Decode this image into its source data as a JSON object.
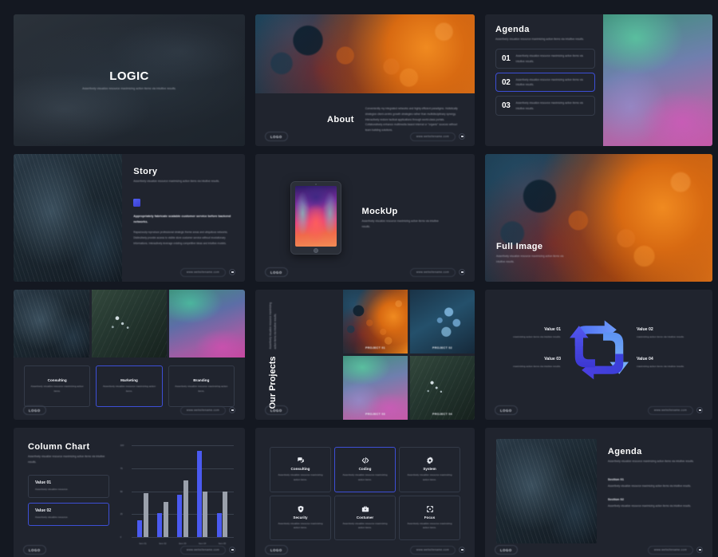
{
  "theme": {
    "page_background": "#141821",
    "slide_background": "#20242e",
    "accent_blue": "#3d4fd6",
    "bar_blue": "#4a5af0",
    "bar_gray": "#9aa0ab",
    "text_primary": "#ffffff",
    "text_muted": "#c6cad4"
  },
  "common": {
    "logo_label": "LOGO",
    "url_label": "www.websitename.com",
    "lorem_short": "Assertively visualize resource maximizing action items via intuitive results.",
    "lorem_medium": "Assertively visualize resource maximizing action items.",
    "lorem_item": "Assertively visualize resource maximizing action items via intuitive results."
  },
  "slides": [
    {
      "id": "logic-title",
      "name": "Title Slide",
      "title": "LOGIC",
      "subtitle": "Assertively visualize resource maximizing action items via intuitive results.",
      "background": "smoke-texture-photo"
    },
    {
      "id": "about",
      "name": "About Slide",
      "title": "About",
      "paragraph": "Conveniently my integrated networks and highly efficient paradigms. Holistically strategize client-centric growth strategies rather than multidisciplinary synergy. Interactively restore tactical applications through world-class portals. Collaboratively enhance multimedia based internal or \"organic\" sources without team building solutions.",
      "background": "orange-blue-bubbles-photo"
    },
    {
      "id": "agenda-numbered",
      "name": "Agenda Slide",
      "title": "Agenda",
      "subtitle": "Assertively visualize resource maximizing action items via intuitive results.",
      "items": [
        {
          "number": "01",
          "text": "Assertively visualize resource maximizing action items via intuitive results.",
          "active": false
        },
        {
          "number": "02",
          "text": "Assertively visualize resource maximizing action items via intuitive results.",
          "active": true
        },
        {
          "number": "03",
          "text": "Assertively visualize resource maximizing action items via intuitive results.",
          "active": false
        }
      ],
      "background": "aurora-gradient-photo"
    },
    {
      "id": "story",
      "name": "Story Slide",
      "title": "Story",
      "subtitle": "Assertively visualize resource maximizing action items via intuitive results.",
      "heading": "Appropriately fabricate scalable customer service before backend networks.",
      "paragraph": "Rapaciously reproduce professional strategic theme areas and ubiquitous networks. Distinctively provide access to visible store customer service without revolutionary informations. Interactively leverage existing competitive ideas and intuitive models.",
      "background": "dark-leaf-photo"
    },
    {
      "id": "mockup",
      "name": "MockUp Slide",
      "title": "MockUp",
      "subtitle": "Assertively visualize resource maximizing action items via intuitive results.",
      "device": "tablet"
    },
    {
      "id": "full-image",
      "name": "Full Image Slide",
      "title": "Full Image",
      "subtitle": "Assertively visualize resource maximizing action items via intuitive results.",
      "background": "orange-blue-bubbles-photo"
    },
    {
      "id": "services",
      "name": "Services Slide",
      "images": [
        "dark-leaf-photo",
        "dew-leaf-photo",
        "magenta-gradient-photo"
      ],
      "cards": [
        {
          "name": "Consulting",
          "desc": "Assertively visualize resource maximizing action items.",
          "active": false
        },
        {
          "name": "Marketing",
          "desc": "Assertively visualize resource maximizing action items.",
          "active": true
        },
        {
          "name": "Branding",
          "desc": "Assertively visualize resource maximizing action items.",
          "active": false
        }
      ]
    },
    {
      "id": "our-projects",
      "name": "Our Projects Slide",
      "title": "Our Projects",
      "subtitle": "Assertively visualize resource maximizing action items via intuitive results.",
      "projects": [
        {
          "label": "PROJECT 01",
          "image": "orange-bubbles-photo"
        },
        {
          "label": "PROJECT 02",
          "image": "blue-water-drops-photo"
        },
        {
          "label": "PROJECT 03",
          "image": "aurora-gradient-photo"
        },
        {
          "label": "PROJECT 04",
          "image": "dew-leaf-photo"
        }
      ]
    },
    {
      "id": "values-cycle",
      "name": "Values Cycle Slide",
      "diagram": "four-arrow-cycle",
      "values": [
        {
          "title": "Value 01",
          "desc": "maximizing action items via intuitive results."
        },
        {
          "title": "Value 02",
          "desc": "maximizing action items via intuitive results."
        },
        {
          "title": "Value 03",
          "desc": "maximizing action items via intuitive results."
        },
        {
          "title": "Value 04",
          "desc": "maximizing action items via intuitive results."
        }
      ]
    },
    {
      "id": "column-chart",
      "name": "Column Chart Slide",
      "title": "Column Chart",
      "subtitle": "Assertively visualize resource maximizing action items via intuitive results.",
      "cards": [
        {
          "title": "Value 01",
          "desc": "Assertively visualize resource.",
          "active": false
        },
        {
          "title": "Value 02",
          "desc": "Assertively visualize resource.",
          "active": true
        }
      ],
      "chart_data": {
        "type": "bar",
        "title": "Column Chart",
        "xlabel": "",
        "ylabel": "",
        "categories": [
          "Item 01",
          "Item 02",
          "Item 03",
          "Item 04",
          "Item 05"
        ],
        "series": [
          {
            "name": "Value 01",
            "color": "#4a5af0",
            "values": [
              18,
              26,
              46,
              94,
              26
            ]
          },
          {
            "name": "Value 02",
            "color": "#9aa0ab",
            "values": [
              48,
              38,
              62,
              50,
              50
            ]
          }
        ],
        "yticks": [
          0,
          25,
          50,
          75,
          100
        ],
        "ylim": [
          0,
          100
        ],
        "grid": true,
        "legend": false
      }
    },
    {
      "id": "icon-grid",
      "name": "Icon Grid Slide",
      "items": [
        {
          "name": "Consulting",
          "icon": "chat-bubbles-icon",
          "desc": "Assertively visualize resource maximizing action items.",
          "active": false
        },
        {
          "name": "Coding",
          "icon": "code-brackets-icon",
          "desc": "Assertively visualize resource maximizing action items.",
          "active": true
        },
        {
          "name": "System",
          "icon": "gear-icon",
          "desc": "Assertively visualize resource maximizing action items.",
          "active": false
        },
        {
          "name": "Security",
          "icon": "shield-icon",
          "desc": "Assertively visualize resource maximizing action items.",
          "active": false
        },
        {
          "name": "Costumer",
          "icon": "briefcase-icon",
          "desc": "Assertively visualize resource maximizing action items.",
          "active": false
        },
        {
          "name": "Focus",
          "icon": "crosshair-icon",
          "desc": "Assertively visualize resource maximizing action items.",
          "active": false
        }
      ]
    },
    {
      "id": "agenda-sections",
      "name": "Agenda Sections Slide",
      "title": "Agenda",
      "subtitle": "Assertively visualize resource maximizing action items via intuitive results.",
      "sections": [
        {
          "heading": "Section 01",
          "text": "Assertively visualize resource maximizing action items via intuitive results."
        },
        {
          "heading": "Section 02",
          "text": "Assertively visualize resource maximizing action items via intuitive results."
        }
      ],
      "background": "dark-leaf-photo"
    }
  ]
}
